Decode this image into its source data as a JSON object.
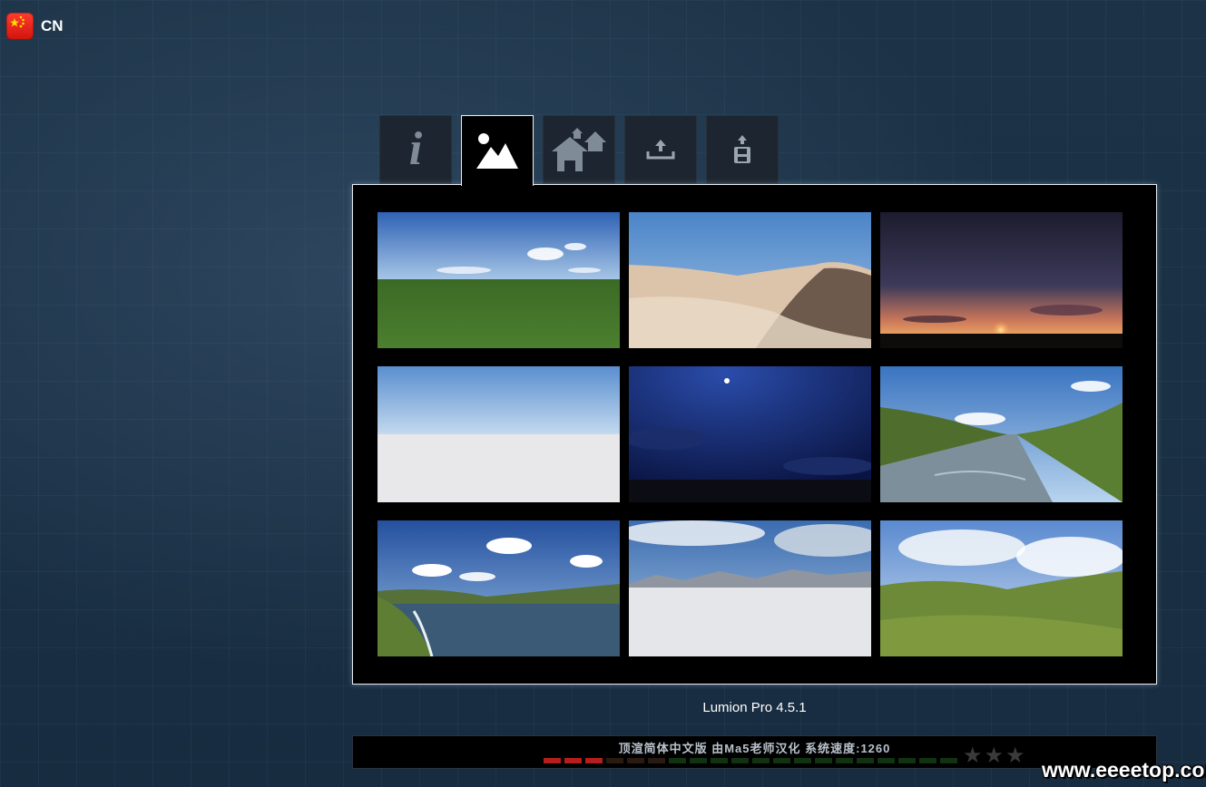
{
  "language": {
    "code": "CN",
    "flag": "china-flag-icon"
  },
  "tabs": [
    {
      "name": "info",
      "icon": "info-icon",
      "active": false
    },
    {
      "name": "landscape",
      "icon": "landscape-icon",
      "active": true
    },
    {
      "name": "new-scene",
      "icon": "houses-icon",
      "active": false
    },
    {
      "name": "load-scene",
      "icon": "upload-icon",
      "active": false
    },
    {
      "name": "save-scene",
      "icon": "save-icon",
      "active": false
    }
  ],
  "thumbnails": [
    {
      "name": "grassland-scene",
      "theme": "grass"
    },
    {
      "name": "desert-scene",
      "theme": "desert"
    },
    {
      "name": "sunset-scene",
      "theme": "sunset"
    },
    {
      "name": "white-plane-scene",
      "theme": "white"
    },
    {
      "name": "night-scene",
      "theme": "night"
    },
    {
      "name": "river-valley-scene",
      "theme": "river"
    },
    {
      "name": "lake-scene",
      "theme": "lake"
    },
    {
      "name": "snow-scene",
      "theme": "snow"
    },
    {
      "name": "green-hills-scene",
      "theme": "hills"
    }
  ],
  "version": "Lumion Pro 4.5.1",
  "status_bar": {
    "text": "顶渲简体中文版 由Ma5老师汉化 系统速度:1260",
    "speed_level": 3,
    "speed_segments": 20,
    "stars": 3
  },
  "watermark": "www.eeeetop.com",
  "colors": {
    "background": "#1a3045",
    "panel": "#000000",
    "panel_border": "#e8eef3",
    "meter_on": "#b41e1e"
  }
}
